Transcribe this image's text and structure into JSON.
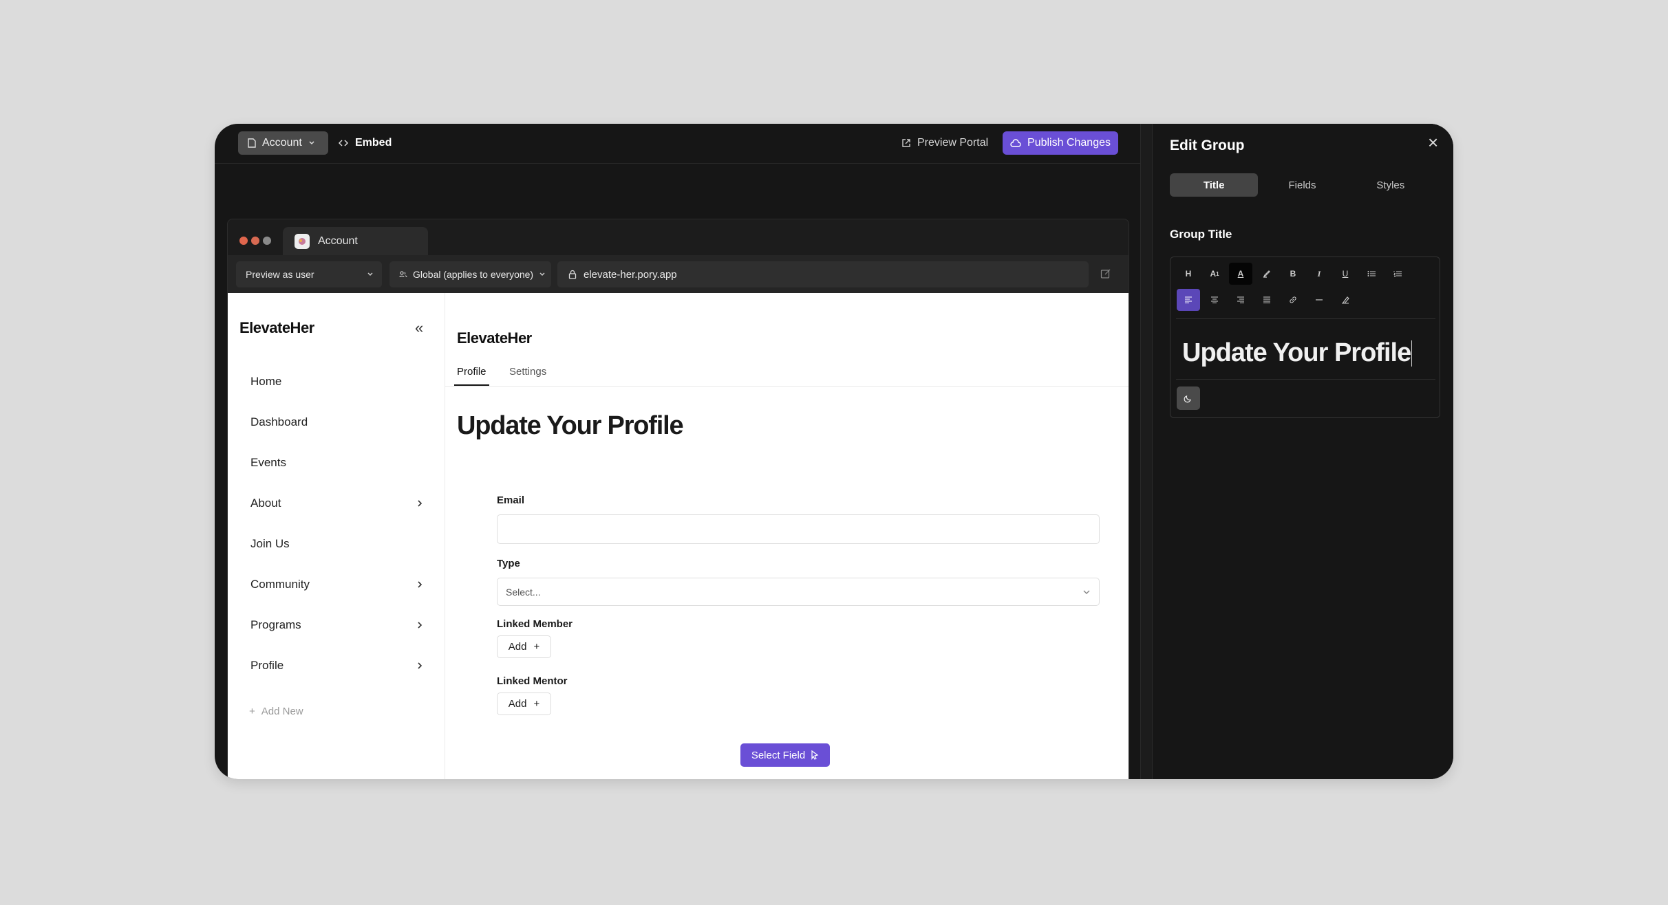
{
  "topbar": {
    "account_label": "Account",
    "embed_label": "Embed",
    "preview_label": "Preview Portal",
    "publish_label": "Publish Changes"
  },
  "browser": {
    "tab_title": "Account",
    "preview_as": "Preview as user",
    "scope": "Global (applies to everyone)",
    "url": "elevate-her.pory.app",
    "traffic_colors": [
      "#e0664d",
      "#d86a52",
      "#8a8a8a"
    ]
  },
  "sidebar": {
    "brand": "ElevateHer",
    "items": [
      {
        "label": "Home",
        "has_chevron": false
      },
      {
        "label": "Dashboard",
        "has_chevron": false
      },
      {
        "label": "Events",
        "has_chevron": false
      },
      {
        "label": "About",
        "has_chevron": true
      },
      {
        "label": "Join Us",
        "has_chevron": false
      },
      {
        "label": "Community",
        "has_chevron": true
      },
      {
        "label": "Programs",
        "has_chevron": true
      },
      {
        "label": "Profile",
        "has_chevron": true
      }
    ],
    "add_new": "Add New"
  },
  "main": {
    "brand": "ElevateHer",
    "tabs": [
      {
        "label": "Profile",
        "active": true
      },
      {
        "label": "Settings",
        "active": false
      }
    ],
    "heading": "Update Your Profile",
    "email_label": "Email",
    "email_value": "",
    "type_label": "Type",
    "type_placeholder": "Select...",
    "linked_member_label": "Linked Member",
    "linked_mentor_label": "Linked Mentor",
    "add_label": "Add",
    "select_field_label": "Select Field"
  },
  "panel": {
    "title": "Edit Group",
    "tabs": [
      {
        "label": "Title",
        "active": true
      },
      {
        "label": "Fields",
        "active": false
      },
      {
        "label": "Styles",
        "active": false
      }
    ],
    "section_title": "Group Title",
    "editor_text": "Update Your Profile",
    "toolbar_row1": [
      "heading-icon",
      "superscript-icon",
      "text-color-icon",
      "highlighter-icon",
      "bold-icon",
      "italic-icon",
      "underline-icon",
      "bullet-list-icon",
      "numbered-list-icon"
    ],
    "toolbar_row2": [
      "align-left-icon",
      "align-center-icon",
      "align-right-icon",
      "align-justify-icon",
      "link-icon",
      "horizontal-rule-icon",
      "clear-format-icon"
    ]
  },
  "colors": {
    "accent": "#6a4fd6",
    "window_bg": "#161616",
    "page_bg": "#dcdcdc"
  }
}
